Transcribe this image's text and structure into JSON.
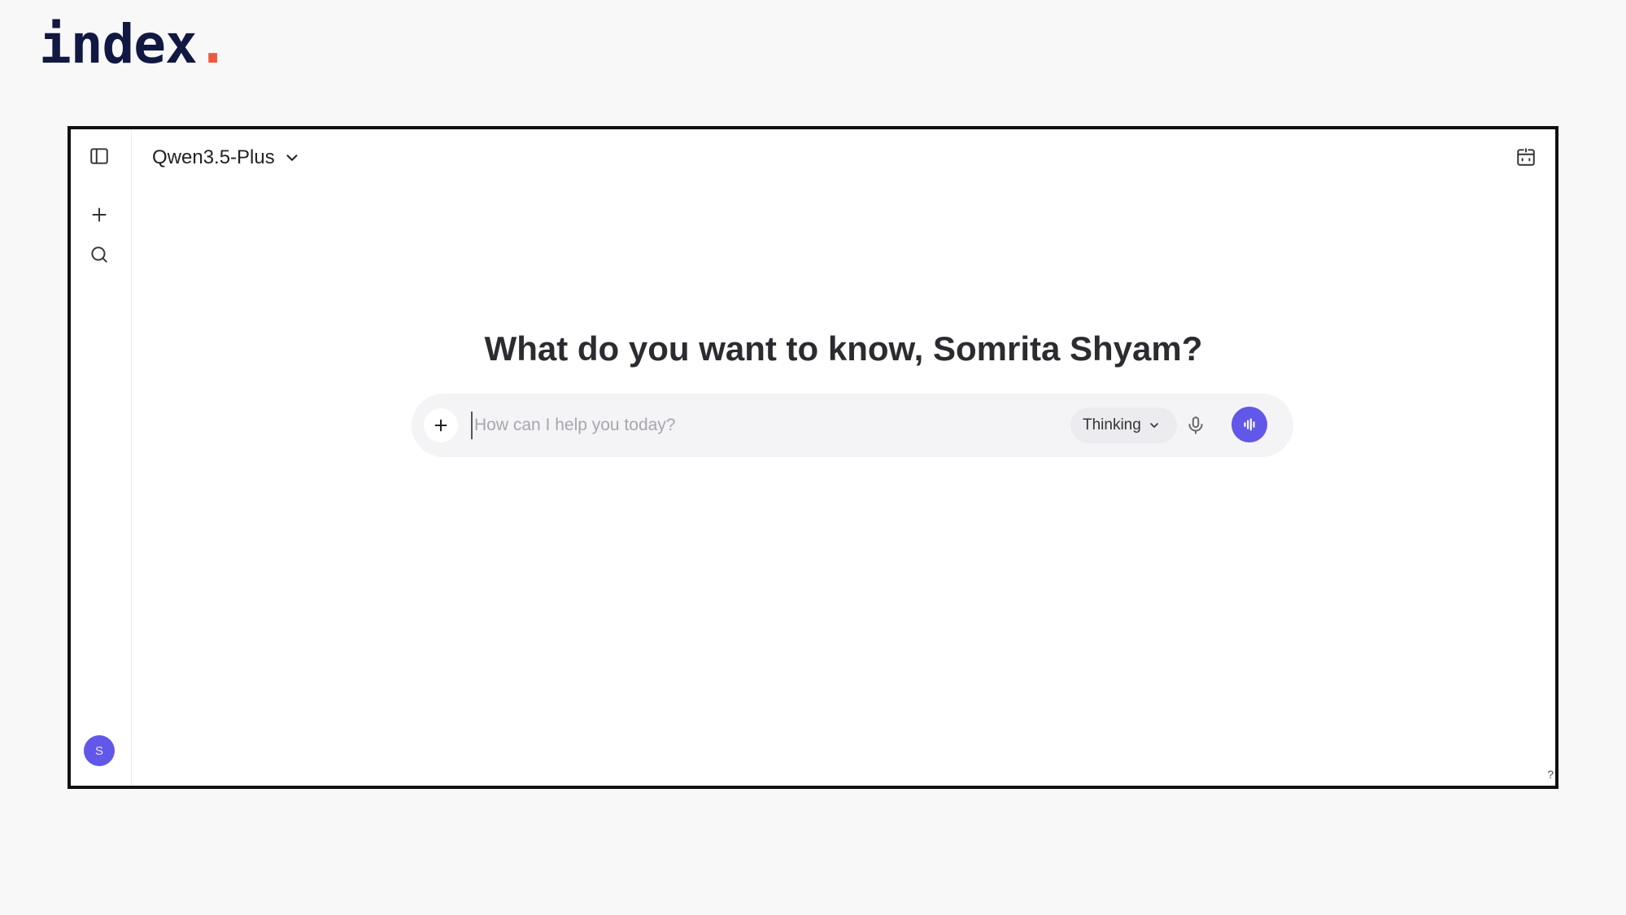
{
  "brand": {
    "name": "index",
    "dot": "."
  },
  "header": {
    "model_name": "Qwen3.5-Plus"
  },
  "main": {
    "greeting": "What do you want to know, Somrita Shyam?"
  },
  "composer": {
    "placeholder": "How can I help you today?",
    "value": "",
    "mode_label": "Thinking"
  },
  "user": {
    "avatar_initial": "S"
  },
  "footer": {
    "help_label": "?"
  },
  "icons": {
    "sidebar_toggle": "sidebar-toggle-icon",
    "new_chat": "plus-icon",
    "search": "search-icon",
    "share": "share-window-icon",
    "attach": "plus-icon",
    "mode_dropdown": "chevron-down-icon",
    "mic": "microphone-icon",
    "voice": "audio-waveform-icon"
  },
  "colors": {
    "page_background": "#f8f8f9",
    "brand_text": "#111842",
    "brand_dot": "#ef5a3a",
    "accent": "#6157e9",
    "frame_border": "#111111",
    "composer_background": "#f4f4f6"
  }
}
